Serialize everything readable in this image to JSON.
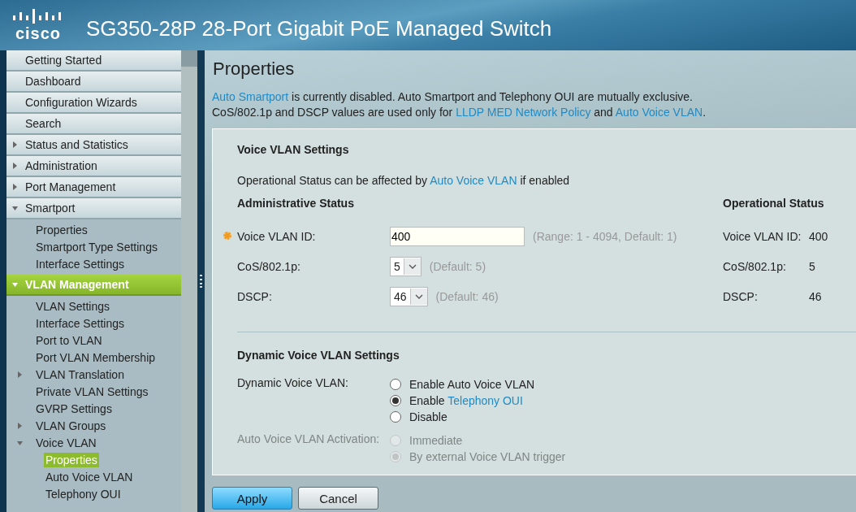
{
  "header": {
    "logo_text": "cisco",
    "title": "SG350-28P 28-Port Gigabit PoE Managed Switch"
  },
  "sidebar": {
    "items": [
      {
        "label": "Getting Started",
        "selected": false
      },
      {
        "label": "Dashboard",
        "selected": false
      },
      {
        "label": "Configuration Wizards",
        "selected": false
      },
      {
        "label": "Search",
        "selected": false
      },
      {
        "label": "Status and Statistics",
        "selected": false,
        "expanded": false
      },
      {
        "label": "Administration",
        "selected": false,
        "expanded": false
      },
      {
        "label": "Port Management",
        "selected": false,
        "expanded": false
      },
      {
        "label": "Smartport",
        "selected": false,
        "expanded": true,
        "children": [
          {
            "label": "Properties",
            "selected": false
          },
          {
            "label": "Smartport Type Settings",
            "selected": false
          },
          {
            "label": "Interface Settings",
            "selected": false
          }
        ]
      },
      {
        "label": "VLAN Management",
        "selected": true,
        "expanded": true,
        "children": [
          {
            "label": "VLAN Settings",
            "selected": false
          },
          {
            "label": "Interface Settings",
            "selected": false
          },
          {
            "label": "Port to VLAN",
            "selected": false
          },
          {
            "label": "Port VLAN Membership",
            "selected": false
          },
          {
            "label": "VLAN Translation",
            "selected": false,
            "expanded": false
          },
          {
            "label": "Private VLAN Settings",
            "selected": false
          },
          {
            "label": "GVRP Settings",
            "selected": false
          },
          {
            "label": "VLAN Groups",
            "selected": false,
            "expanded": false
          },
          {
            "label": "Voice VLAN",
            "selected": false,
            "expanded": true,
            "children": [
              {
                "label": "Properties",
                "selected": true
              },
              {
                "label": "Auto Voice VLAN",
                "selected": false
              },
              {
                "label": "Telephony OUI",
                "selected": false
              }
            ]
          }
        ]
      }
    ]
  },
  "page": {
    "title": "Properties",
    "intro": [
      [
        {
          "text": "Auto Smartport",
          "link": true
        },
        {
          "text": " is currently disabled. Auto Smartport and Telephony OUI are mutually exclusive.",
          "link": false
        }
      ],
      [
        {
          "text": "CoS/802.1p and DSCP values are used only for ",
          "link": false
        },
        {
          "text": "LLDP MED Network Policy",
          "link": true
        },
        {
          "text": " and ",
          "link": false
        },
        {
          "text": "Auto Voice VLAN",
          "link": true
        },
        {
          "text": ".",
          "link": false
        }
      ]
    ],
    "voice_vlan_settings": {
      "title": "Voice VLAN Settings",
      "note": [
        {
          "text": "Operational Status can be affected by ",
          "link": false
        },
        {
          "text": "Auto Voice VLAN",
          "link": true
        },
        {
          "text": " if enabled",
          "link": false
        }
      ],
      "admin_heading": "Administrative Status",
      "oper_heading": "Operational Status",
      "fields": [
        {
          "kind": "input",
          "label": "Voice VLAN ID:",
          "required": true,
          "value": "400",
          "hint": "(Range: 1 - 4094, Default: 1)"
        },
        {
          "kind": "select",
          "label": "CoS/802.1p:",
          "required": false,
          "value": "5",
          "hint": "(Default: 5)"
        },
        {
          "kind": "select",
          "label": "DSCP:",
          "required": false,
          "value": "46",
          "hint": "(Default: 46)"
        }
      ],
      "operational": [
        {
          "label": "Voice VLAN ID:",
          "value": "400"
        },
        {
          "label": "CoS/802.1p:",
          "value": "5"
        },
        {
          "label": "DSCP:",
          "value": "46"
        }
      ]
    },
    "dynamic_settings": {
      "title": "Dynamic Voice VLAN Settings",
      "groups": [
        {
          "label": "Dynamic Voice VLAN:",
          "disabled": false,
          "options": [
            {
              "text": [
                {
                  "text": "Enable Auto Voice VLAN",
                  "link": false
                }
              ],
              "selected": false
            },
            {
              "text": [
                {
                  "text": "Enable ",
                  "link": false
                },
                {
                  "text": "Telephony OUI",
                  "link": true
                }
              ],
              "selected": true
            },
            {
              "text": [
                {
                  "text": "Disable",
                  "link": false
                }
              ],
              "selected": false
            }
          ]
        },
        {
          "label": "Auto Voice VLAN Activation:",
          "disabled": true,
          "options": [
            {
              "text": [
                {
                  "text": "Immediate",
                  "link": false
                }
              ],
              "selected": false
            },
            {
              "text": [
                {
                  "text": "By external Voice VLAN trigger",
                  "link": false
                }
              ],
              "selected": true
            }
          ]
        }
      ]
    },
    "buttons": [
      {
        "label": "Apply",
        "primary": true
      },
      {
        "label": "Cancel",
        "primary": false
      }
    ]
  }
}
